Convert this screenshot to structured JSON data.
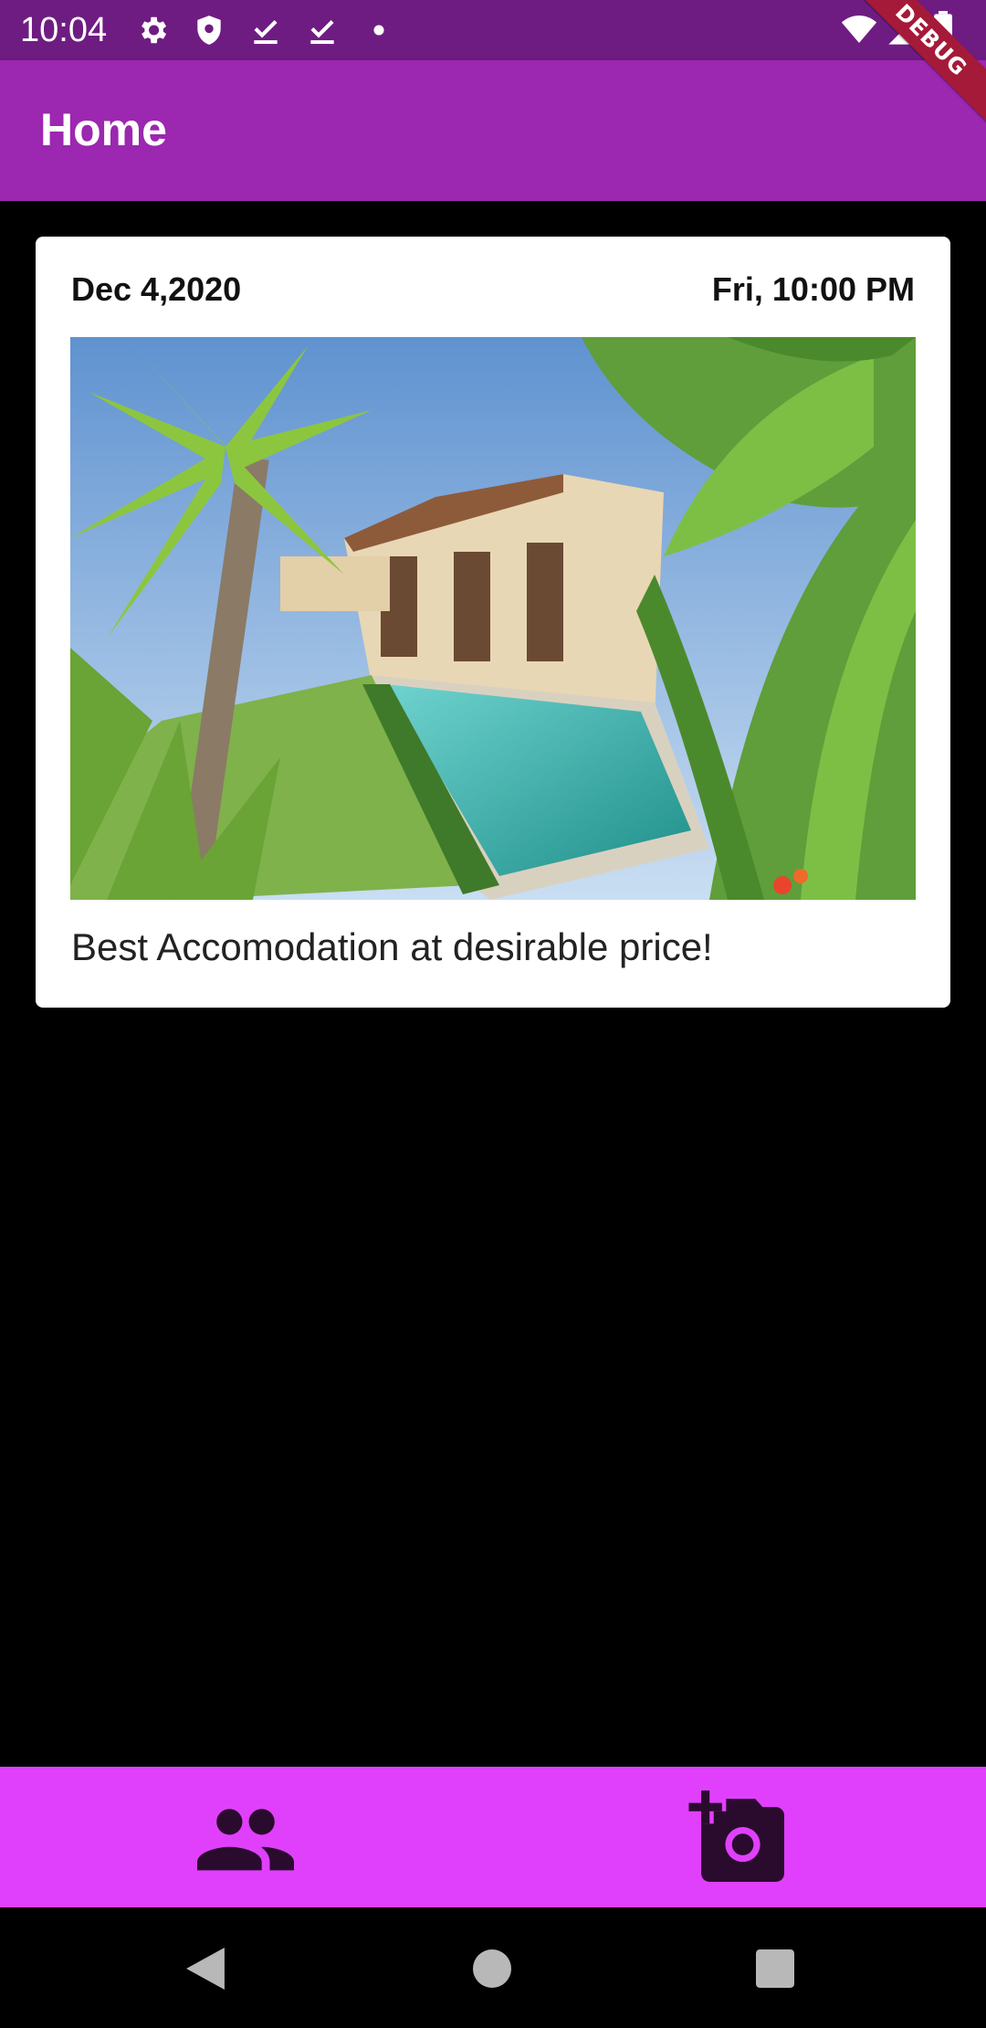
{
  "status_bar": {
    "time": "10:04",
    "left_icons": [
      "settings-icon",
      "shield-icon",
      "download-done-icon",
      "download-done-icon",
      "dot-icon"
    ],
    "right_icons": [
      "wifi-icon",
      "signal-icon",
      "battery-icon"
    ],
    "debug_label": "DEBUG",
    "background": "#6f1c82"
  },
  "app_bar": {
    "title": "Home",
    "background": "#9c27b0"
  },
  "post": {
    "date": "Dec 4,2020",
    "time": "Fri, 10:00 PM",
    "image_alt": "villa-with-pool-photo",
    "caption": "Best Accomodation at desirable price!"
  },
  "bottom_nav": {
    "background": "#e040fb",
    "items": [
      {
        "icon": "people-icon"
      },
      {
        "icon": "add-a-photo-icon"
      }
    ]
  },
  "system_nav": {
    "items": [
      "back-icon",
      "home-icon",
      "recents-icon"
    ]
  }
}
